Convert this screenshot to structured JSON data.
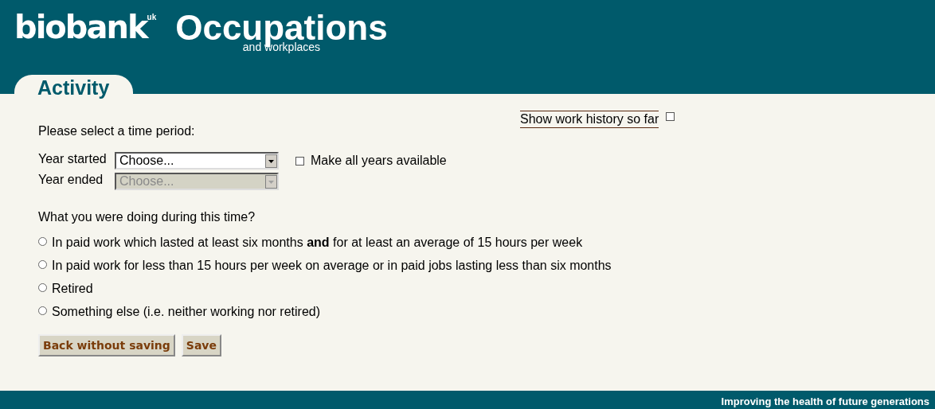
{
  "header": {
    "logo": "biobank",
    "logo_sup": "uk",
    "title": "Occupations",
    "subtitle": "and workplaces"
  },
  "tab": {
    "label": "Activity"
  },
  "history": {
    "label": "Show work history so far",
    "checked": false
  },
  "prompt": "Please select a time period:",
  "fields": [
    {
      "label": "Year started",
      "value": "Choose...",
      "disabled": false
    },
    {
      "label": "Year ended",
      "value": "Choose...",
      "disabled": true
    }
  ],
  "all_years": {
    "label": "Make all years available",
    "checked": false
  },
  "question": "What you were doing during this time?",
  "options": [
    {
      "label": "In paid work which lasted at least six months **and** for at least an average of 15 hours per week",
      "selected": false
    },
    {
      "label": "In paid work for less than 15 hours per week on average or in paid jobs lasting less than six months",
      "selected": false
    },
    {
      "label": "Retired",
      "selected": false
    },
    {
      "label": "Something else (i.e. neither working nor retired)",
      "selected": false
    }
  ],
  "buttons": [
    "Back without saving",
    "Save"
  ],
  "footer": "Improving the health of future generations"
}
